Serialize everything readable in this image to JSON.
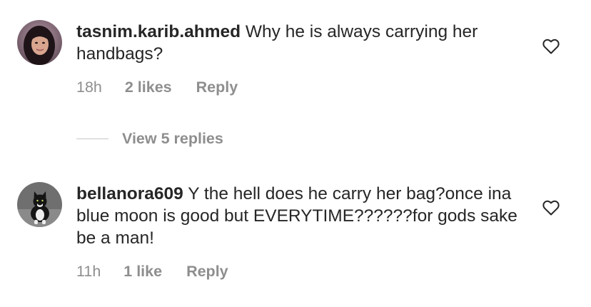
{
  "comments": [
    {
      "username": "tasnim.karib.ahmed",
      "text": "Why he is always carrying her handbags?",
      "time": "18h",
      "likes": "2 likes",
      "reply_label": "Reply",
      "view_replies": "View 5 replies"
    },
    {
      "username": "bellanora609",
      "text": "Y the hell does he carry her bag?once ina blue moon is good but EVERYTIME??????for gods sake be a man!",
      "time": "11h",
      "likes": "1 like",
      "reply_label": "Reply"
    }
  ],
  "icons": {
    "avatar_1": "user-avatar-woman",
    "avatar_2": "user-avatar-cat",
    "like": "heart-outline-icon"
  },
  "colors": {
    "text": "#262626",
    "secondary": "#8e8e8e"
  }
}
